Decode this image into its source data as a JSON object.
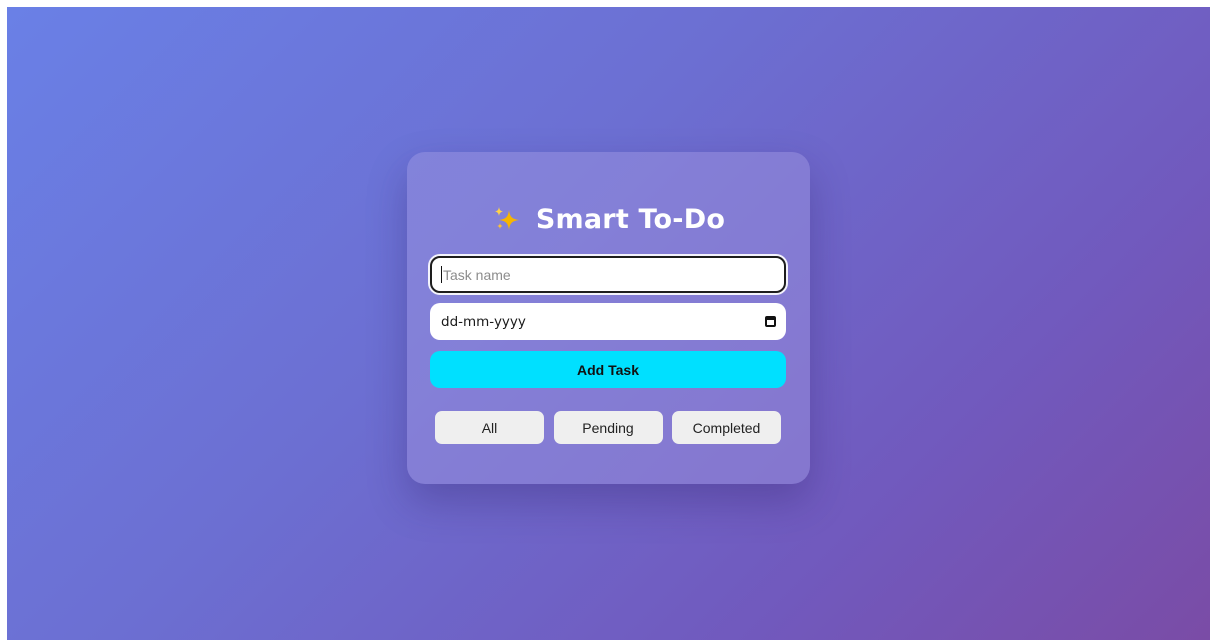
{
  "app": {
    "title": "Smart To-Do",
    "title_icon": "sparkles-icon"
  },
  "form": {
    "task_placeholder": "Task name",
    "task_value": "",
    "date_placeholder": "dd-mm-yyyy",
    "date_icon": "calendar-icon",
    "add_label": "Add Task"
  },
  "filters": [
    {
      "label": "All"
    },
    {
      "label": "Pending"
    },
    {
      "label": "Completed"
    }
  ],
  "colors": {
    "background_start": "#6a80e6",
    "background_end": "#7a4ca6",
    "accent": "#00e0ff",
    "sparkle": "#f7b500"
  }
}
